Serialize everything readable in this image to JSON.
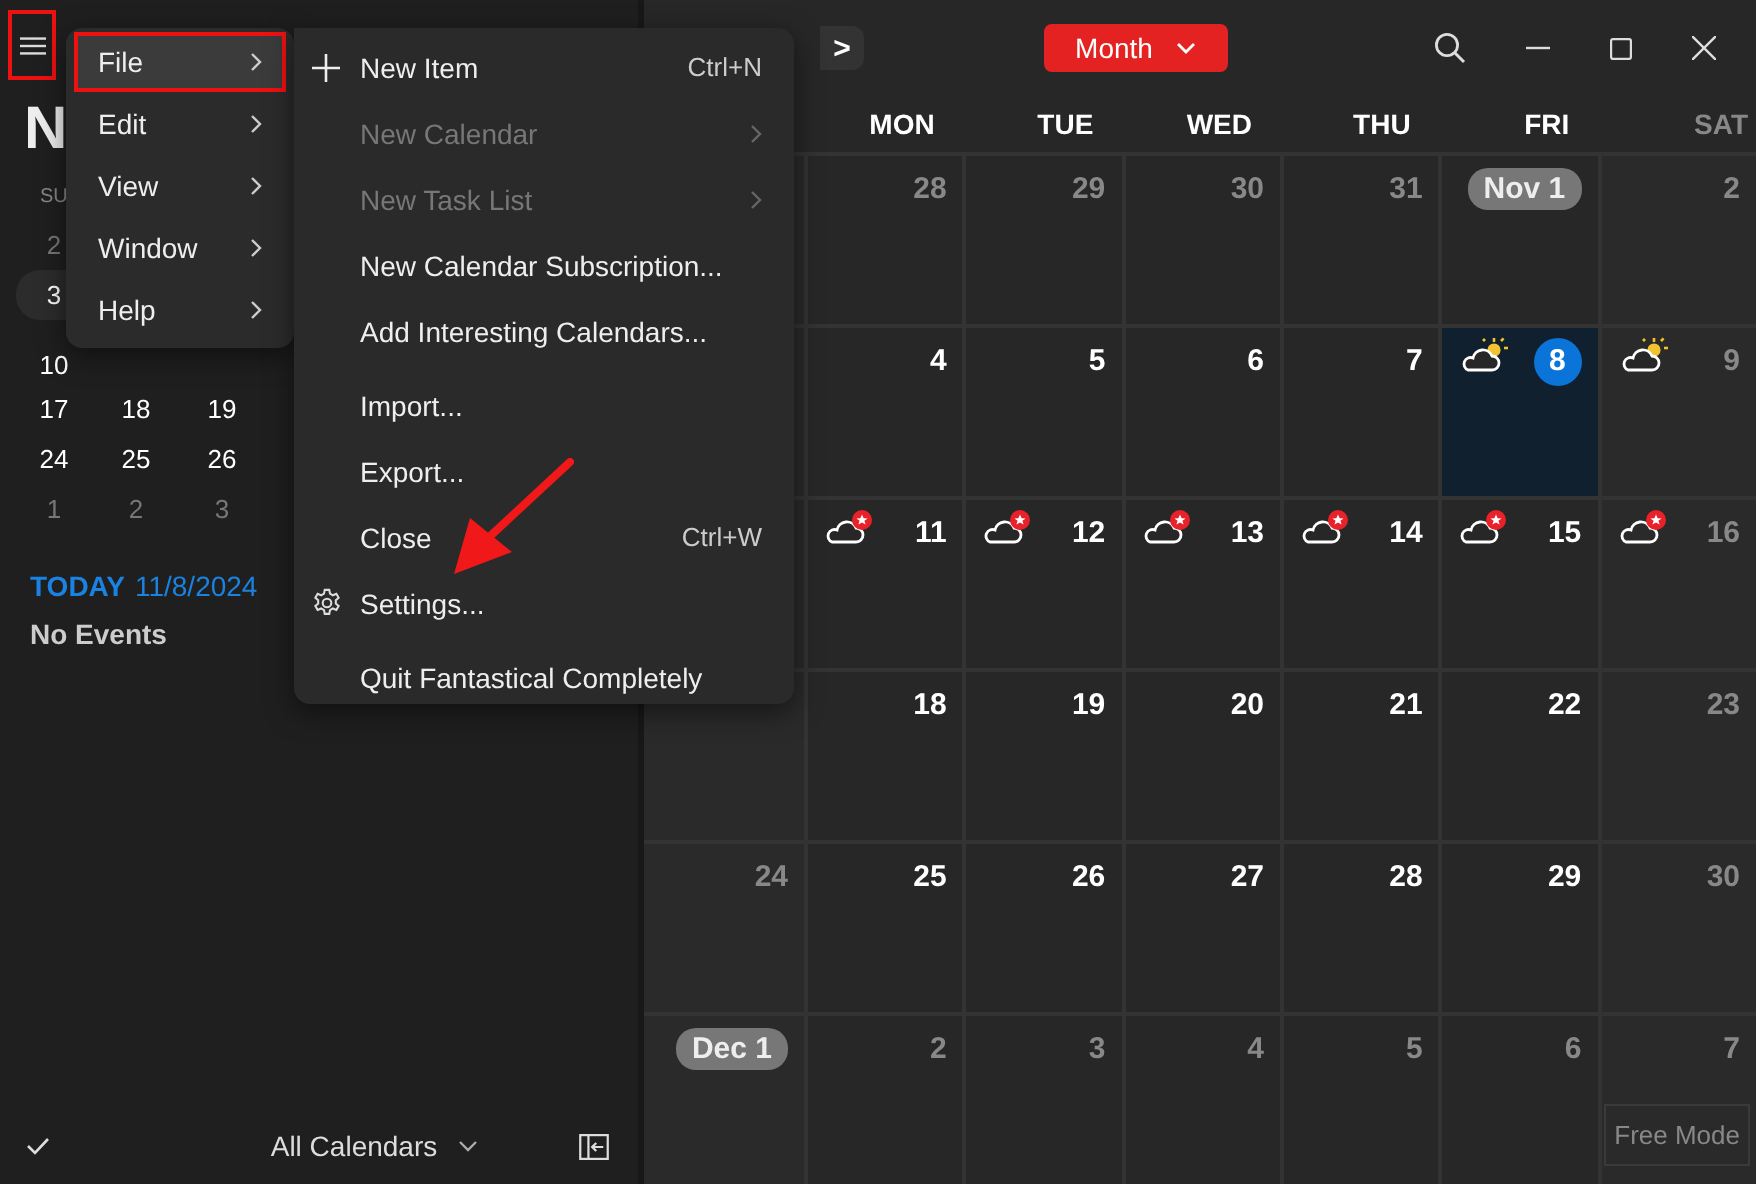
{
  "sidebar": {
    "menu_button": {
      "highlighted": true
    },
    "month_title": "N",
    "weekday": "SU",
    "weeks": [
      {
        "current": false,
        "days": [
          {
            "text": "2",
            "muted": true
          }
        ]
      },
      {
        "current": true,
        "days": [
          {
            "text": "3",
            "muted": false
          }
        ]
      },
      {
        "current": false,
        "days": [
          {
            "text": "10",
            "muted": false
          }
        ]
      },
      {
        "current": false,
        "days": [
          {
            "text": "17",
            "muted": false
          },
          {
            "text": "18",
            "muted": false
          },
          {
            "text": "19",
            "muted": false
          }
        ]
      },
      {
        "current": false,
        "days": [
          {
            "text": "24",
            "muted": false
          },
          {
            "text": "25",
            "muted": false
          },
          {
            "text": "26",
            "muted": false
          }
        ]
      },
      {
        "current": false,
        "days": [
          {
            "text": "1",
            "muted": true
          },
          {
            "text": "2",
            "muted": true
          },
          {
            "text": "3",
            "muted": true
          }
        ]
      }
    ],
    "today_label": "TODAY",
    "today_date": "11/8/2024",
    "events_text": "No Events",
    "calendars_button": "All Calendars"
  },
  "toolbar": {
    "next": ">",
    "view_button": "Month"
  },
  "weekdays": [
    "MON",
    "TUE",
    "WED",
    "THU",
    "FRI",
    "SAT"
  ],
  "weeks": [
    [
      {
        "kind": "hidden"
      },
      {
        "kind": "muted",
        "day": "28"
      },
      {
        "kind": "muted",
        "day": "29"
      },
      {
        "kind": "muted",
        "day": "30"
      },
      {
        "kind": "muted",
        "day": "31"
      },
      {
        "kind": "pill",
        "day": "Nov 1"
      },
      {
        "kind": "muted",
        "day": "2"
      }
    ],
    [
      {
        "kind": "hidden"
      },
      {
        "kind": "normal",
        "day": "4"
      },
      {
        "kind": "normal",
        "day": "5"
      },
      {
        "kind": "normal",
        "day": "6"
      },
      {
        "kind": "normal",
        "day": "7"
      },
      {
        "kind": "today",
        "day": "8",
        "weather": {
          "kind": "partly_sunny"
        }
      },
      {
        "kind": "muted",
        "day": "9",
        "weather": {
          "kind": "partly_sunny"
        }
      }
    ],
    [
      {
        "kind": "hidden"
      },
      {
        "kind": "normal",
        "day": "11",
        "weather": {
          "kind": "alert"
        }
      },
      {
        "kind": "normal",
        "day": "12",
        "weather": {
          "kind": "alert"
        }
      },
      {
        "kind": "normal",
        "day": "13",
        "weather": {
          "kind": "alert"
        }
      },
      {
        "kind": "normal",
        "day": "14",
        "weather": {
          "kind": "alert"
        }
      },
      {
        "kind": "normal",
        "day": "15",
        "weather": {
          "kind": "alert"
        }
      },
      {
        "kind": "muted",
        "day": "16",
        "weather": {
          "kind": "alert"
        }
      }
    ],
    [
      {
        "kind": "hidden"
      },
      {
        "kind": "normal",
        "day": "18"
      },
      {
        "kind": "normal",
        "day": "19"
      },
      {
        "kind": "normal",
        "day": "20"
      },
      {
        "kind": "normal",
        "day": "21"
      },
      {
        "kind": "normal",
        "day": "22"
      },
      {
        "kind": "muted",
        "day": "23"
      }
    ],
    [
      {
        "kind": "muted",
        "day": "24"
      },
      {
        "kind": "normal",
        "day": "25"
      },
      {
        "kind": "normal",
        "day": "26"
      },
      {
        "kind": "normal",
        "day": "27"
      },
      {
        "kind": "normal",
        "day": "28"
      },
      {
        "kind": "normal",
        "day": "29"
      },
      {
        "kind": "muted",
        "day": "30"
      }
    ],
    [
      {
        "kind": "pill",
        "day": "Dec 1"
      },
      {
        "kind": "muted",
        "day": "2"
      },
      {
        "kind": "muted",
        "day": "3"
      },
      {
        "kind": "muted",
        "day": "4"
      },
      {
        "kind": "muted",
        "day": "5"
      },
      {
        "kind": "muted",
        "day": "6"
      },
      {
        "kind": "muted",
        "day": "7"
      }
    ]
  ],
  "free_mode_button": "Free Mode",
  "menu": {
    "items": [
      {
        "label": "File",
        "selected": true,
        "highlighted": true
      },
      {
        "label": "Edit",
        "selected": false,
        "highlighted": false
      },
      {
        "label": "View",
        "selected": false,
        "highlighted": false
      },
      {
        "label": "Window",
        "selected": false,
        "highlighted": false
      },
      {
        "label": "Help",
        "selected": false,
        "highlighted": false
      }
    ]
  },
  "submenu": {
    "items": [
      {
        "kind": "add",
        "label": "New Item",
        "shortcut": "Ctrl+N",
        "disabled": false
      },
      {
        "kind": "item",
        "label": "New Calendar",
        "disabled": true,
        "submenu": true
      },
      {
        "kind": "item",
        "label": "New Task List",
        "disabled": true,
        "submenu": true
      },
      {
        "kind": "item",
        "label": "New Calendar Subscription...",
        "disabled": false
      },
      {
        "kind": "item",
        "label": "Add Interesting Calendars...",
        "disabled": false
      },
      {
        "kind": "separator"
      },
      {
        "kind": "item",
        "label": "Import...",
        "disabled": false
      },
      {
        "kind": "item",
        "label": "Export...",
        "disabled": false
      },
      {
        "kind": "item",
        "label": "Close",
        "shortcut": "Ctrl+W",
        "disabled": false
      },
      {
        "kind": "settings",
        "label": "Settings...",
        "disabled": false
      },
      {
        "kind": "separator"
      },
      {
        "kind": "item",
        "label": "Quit Fantastical Completely",
        "disabled": false
      }
    ]
  },
  "annotations": [
    {
      "kind": "arrow"
    }
  ]
}
